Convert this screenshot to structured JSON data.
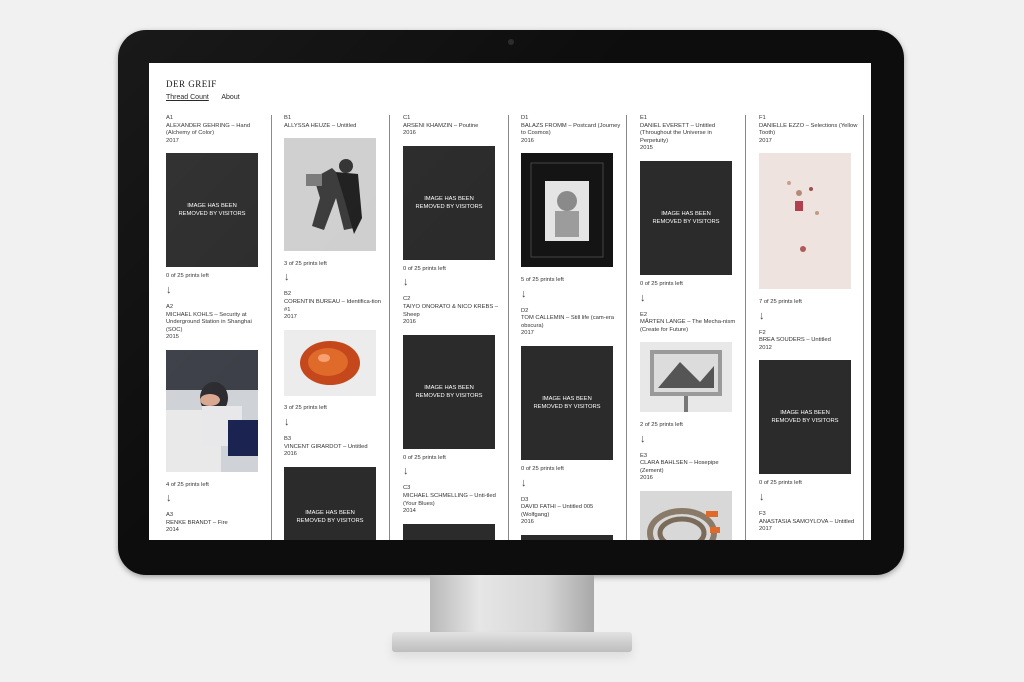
{
  "site": {
    "logo": "DER GREIF",
    "nav": [
      "Thread Count",
      "About"
    ]
  },
  "removed_label": "IMAGE HAS BEEN REMOVED BY VISITORS",
  "columns": [
    {
      "entries": [
        {
          "code": "A1",
          "title": "ALEXANDER GEHRING – Hand (Alchemy of Color)",
          "year": "2017",
          "image": "removed",
          "prints": "0 of 25 prints left"
        },
        {
          "code": "A2",
          "title": "MICHAEL KOHLS – Security at Underground Station in Shanghai (SOC)",
          "year": "2015",
          "image": "photo-woman-hands",
          "prints": "4 of 25 prints left"
        },
        {
          "code": "A3",
          "title": "RENKE BRANDT – Fire",
          "year": "2014",
          "image": "removed",
          "prints": ""
        }
      ]
    },
    {
      "entries": [
        {
          "code": "B1",
          "title": "ALLYSSA HEUZE – Untitled",
          "year": "",
          "image": "photo-figures",
          "prints": "3 of 25 prints left"
        },
        {
          "code": "B2",
          "title": "CORENTIN BUREAU – Identifica-tion #1",
          "year": "2017",
          "image": "photo-red-object",
          "prints": "3 of 25 prints left"
        },
        {
          "code": "B3",
          "title": "VINCENT GIRARDOT – Untitled",
          "year": "2016",
          "image": "removed",
          "prints": ""
        }
      ]
    },
    {
      "entries": [
        {
          "code": "C1",
          "title": "ARSENI KHAMZIN – Poutine",
          "year": "2016",
          "image": "removed",
          "prints": "0 of 25 prints left"
        },
        {
          "code": "C2",
          "title": "TAIYO ONORATO & NICO KREBS – Sheep",
          "year": "2016",
          "image": "removed",
          "prints": "0 of 25 prints left"
        },
        {
          "code": "C3",
          "title": "MICHAEL SCHMELLING – Unti-tled (Your Blues)",
          "year": "2014",
          "image": "removed",
          "prints": ""
        }
      ]
    },
    {
      "entries": [
        {
          "code": "D1",
          "title": "BALAZS FROMM – Postcard (Journey to Cosmos)",
          "year": "2016",
          "image": "photo-astronaut",
          "prints": "5 of 25 prints left"
        },
        {
          "code": "D2",
          "title": "TOM CALLEMIN – Still life (cam-era obscura)",
          "year": "2017",
          "image": "removed",
          "prints": "0 of 25 prints left"
        },
        {
          "code": "D3",
          "title": "DAVID FATHI – Untitled 005 (Wolfgang)",
          "year": "2016",
          "image": "removed",
          "prints": ""
        }
      ]
    },
    {
      "entries": [
        {
          "code": "E1",
          "title": "DANIEL EVERETT – Untitled (Throughout the Universe in Perpetuity)",
          "year": "2015",
          "image": "removed",
          "prints": "0 of 25 prints left"
        },
        {
          "code": "E2",
          "title": "MÅRTEN LANGE – The Mecha-nism (Create for Future)",
          "year": "",
          "image": "photo-billboard",
          "prints": "2 of 25 prints left"
        },
        {
          "code": "E3",
          "title": "CLARA BAHLSEN – Hosepipe (Zement)",
          "year": "2016",
          "image": "photo-hose",
          "prints": ""
        }
      ]
    },
    {
      "entries": [
        {
          "code": "F1",
          "title": "DANIELLE EZZO – Selections (Yellow Tooth)",
          "year": "2017",
          "image": "photo-still-life",
          "prints": "7 of 25 prints left"
        },
        {
          "code": "F2",
          "title": "BREA SOUDERS – Untitled",
          "year": "2012",
          "image": "removed",
          "prints": "0 of 25 prints left"
        },
        {
          "code": "F3",
          "title": "ANASTASIA SAMOYLOVA – Untitled",
          "year": "2017",
          "image": "",
          "prints": ""
        }
      ]
    }
  ]
}
